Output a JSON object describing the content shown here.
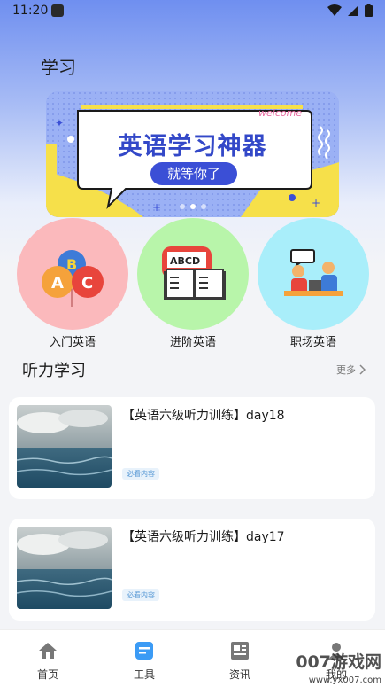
{
  "status": {
    "time": "11:20"
  },
  "header": {
    "title": "学习"
  },
  "banner": {
    "title": "英语学习神器",
    "subtitle": "就等你了",
    "welcome": "welcome",
    "slide_count": 3,
    "active_slide": 1
  },
  "categories": [
    {
      "label": "入门英语",
      "icon": "abc-balloons-icon",
      "color": "#fbb9bc"
    },
    {
      "label": "进阶英语",
      "icon": "abcd-book-icon",
      "color": "#b8f5aa"
    },
    {
      "label": "职场英语",
      "icon": "office-chat-icon",
      "color": "#a9eefa"
    }
  ],
  "listening": {
    "section_title": "听力学习",
    "more_label": "更多",
    "items": [
      {
        "title": "【英语六级听力训练】day18",
        "tag": "必看内容"
      },
      {
        "title": "【英语六级听力训练】day17",
        "tag": "必看内容"
      }
    ]
  },
  "nav": {
    "items": [
      {
        "label": "首页",
        "icon": "home-icon"
      },
      {
        "label": "工具",
        "icon": "tool-icon"
      },
      {
        "label": "资讯",
        "icon": "news-icon"
      },
      {
        "label": "我的",
        "icon": "profile-icon"
      }
    ],
    "active_color": "#3b9bf5"
  },
  "watermark": {
    "text": "007游戏网",
    "url": "www.yx007.com"
  }
}
